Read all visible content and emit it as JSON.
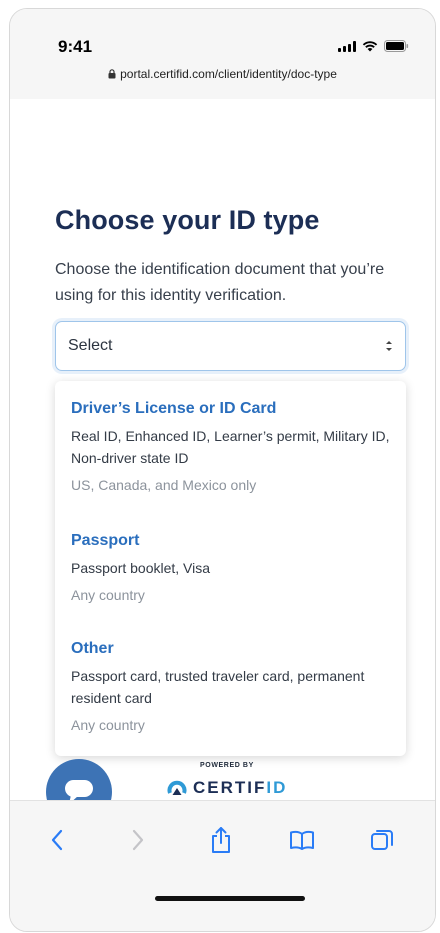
{
  "status_bar": {
    "time": "9:41",
    "url": "portal.certifid.com/client/identity/doc-type"
  },
  "page": {
    "title": "Choose your ID type",
    "description": "Choose the identification document that you’re using for this identity verification."
  },
  "select": {
    "value": "Select",
    "options": [
      {
        "title": "Driver’s License or ID Card",
        "details": "Real ID, Enhanced ID, Learner’s permit, Military ID, Non-driver state ID",
        "scope": "US, Canada, and Mexico only"
      },
      {
        "title": "Passport",
        "details": "Passport booklet, Visa",
        "scope": "Any country"
      },
      {
        "title": "Other",
        "details": "Passport card, trusted traveler card, permanent resident card",
        "scope": "Any country"
      }
    ]
  },
  "footer": {
    "powered_by": "POWERED BY",
    "brand_main": "CERTIF",
    "brand_accent": "ID"
  },
  "colors": {
    "title": "#1c2e55",
    "link": "#2a6ebd",
    "chat_button": "#3d73b5",
    "brand_accent": "#2f9ad6"
  },
  "icons": [
    "signal-icon",
    "wifi-icon",
    "battery-icon",
    "lock-icon",
    "select-arrows-icon",
    "chat-bubble-icon",
    "certifid-logo-icon",
    "back-icon",
    "forward-icon",
    "share-icon",
    "bookmarks-icon",
    "tabs-icon"
  ]
}
